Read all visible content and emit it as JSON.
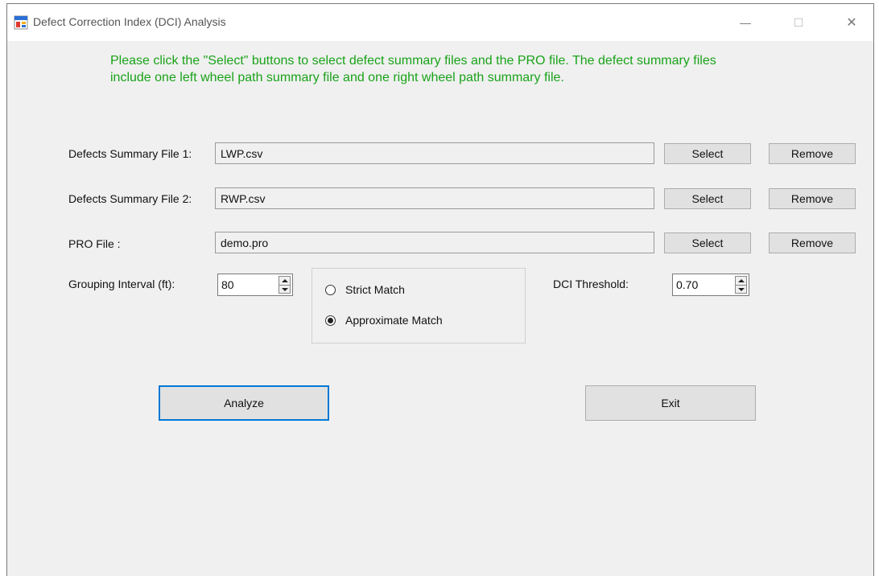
{
  "window": {
    "title": "Defect Correction Index (DCI) Analysis",
    "controls": {
      "minimize": "—",
      "maximize": "☐",
      "close": "✕"
    }
  },
  "instructions": "Please click the \"Select\" buttons to select defect summary files and the PRO file. The defect summary files include one left wheel path summary file and one right wheel path summary file.",
  "files": [
    {
      "label": "Defects Summary File 1:",
      "value": "LWP.csv",
      "select": "Select",
      "remove": "Remove"
    },
    {
      "label": "Defects Summary File 2:",
      "value": "RWP.csv",
      "select": "Select",
      "remove": "Remove"
    },
    {
      "label": "PRO File :",
      "value": "demo.pro",
      "select": "Select",
      "remove": "Remove"
    }
  ],
  "grouping": {
    "label": "Grouping Interval (ft):",
    "value": "80"
  },
  "match": {
    "options": [
      {
        "label": "Strict Match",
        "checked": false
      },
      {
        "label": "Approximate Match",
        "checked": true
      }
    ]
  },
  "threshold": {
    "label": "DCI Threshold:",
    "value": "0.70"
  },
  "actions": {
    "analyze": "Analyze",
    "exit": "Exit"
  },
  "colors": {
    "instruction_text": "#19a319",
    "focus_border": "#0078d7",
    "background": "#f0f0f0"
  }
}
